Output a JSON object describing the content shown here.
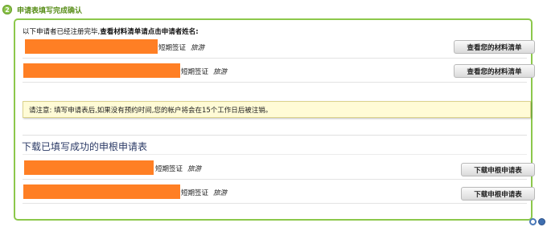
{
  "header": {
    "step_number": "2",
    "title": "申请表填写完成确认"
  },
  "intro": {
    "prefix": "以下申请者已经注册完毕,",
    "bold": "查看材料清单请点击申请者姓名:"
  },
  "applicants": [
    {
      "visa_type": "短期签证",
      "purpose": "旅游",
      "button_label": "查看您的材料清单"
    },
    {
      "visa_type": "短期签证",
      "purpose": "旅游",
      "button_label": "查看您的材料清单"
    }
  ],
  "notice": {
    "text": "请注意:  填写申请表后,如果没有预约时间,您的帐户将会在15个工作日后被注销。"
  },
  "download_section": {
    "title": "下载已填写成功的申根申请表",
    "rows": [
      {
        "visa_type": "短期签证",
        "purpose": "旅游",
        "button_label": "下载申根申请表"
      },
      {
        "visa_type": "短期签证",
        "purpose": "旅游",
        "button_label": "下载申根申请表"
      }
    ]
  },
  "colors": {
    "accent_green": "#8cc84b",
    "redaction": "#ff7f24",
    "notice_bg": "#fffbd6",
    "section_title": "#2b3a66"
  },
  "icons": [
    "step-number-badge",
    "accessibility-icon",
    "help-icon"
  ]
}
